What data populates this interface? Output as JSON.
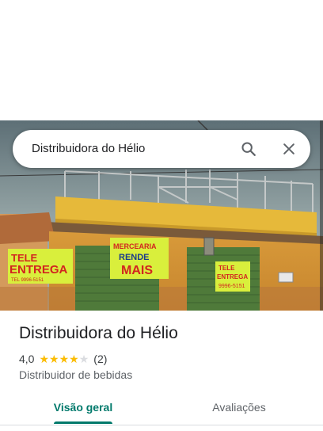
{
  "search": {
    "query": "Distribuidora do Hélio",
    "search_icon": "search-icon",
    "close_icon": "close-icon"
  },
  "photo": {
    "sign_left_top": "TELE",
    "sign_left_main": "ENTREGA",
    "sign_left_phone": "TEL 9996-5151",
    "sign_center_top": "MERCEARIA",
    "sign_center_mid": "RENDE",
    "sign_center_main": "MAIS",
    "sign_right_top": "TELE",
    "sign_right_main": "ENTREGA",
    "sign_right_phone": "9996-5151"
  },
  "place": {
    "name": "Distribuidora do Hélio",
    "rating": "4,0",
    "rating_value": 4,
    "rating_max": 5,
    "review_count": "(2)",
    "category": "Distribuidor de bebidas"
  },
  "tabs": [
    {
      "label": "Visão geral",
      "active": true
    },
    {
      "label": "Avaliações",
      "active": false
    }
  ],
  "colors": {
    "accent": "#00796b",
    "star": "#fbbc04"
  }
}
